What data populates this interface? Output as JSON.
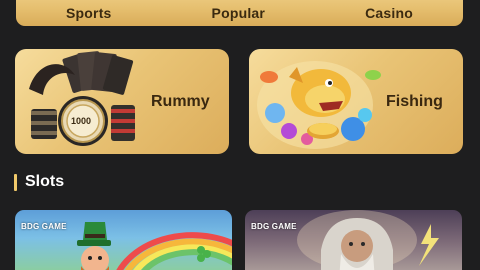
{
  "tabs": [
    {
      "label": "Sports"
    },
    {
      "label": "Popular"
    },
    {
      "label": "Casino"
    }
  ],
  "cards": {
    "rummy": {
      "label": "Rummy",
      "chip_value": "1000"
    },
    "fishing": {
      "label": "Fishing"
    }
  },
  "section": {
    "title": "Slots"
  },
  "slots": [
    {
      "brand": "BDG GAME"
    },
    {
      "brand": "BDG GAME"
    }
  ],
  "colors": {
    "background": "#1e1e1f",
    "gold_light": "#f6dc9c",
    "gold_dark": "#dcad5b",
    "accent_bar": "#f1c96a"
  }
}
